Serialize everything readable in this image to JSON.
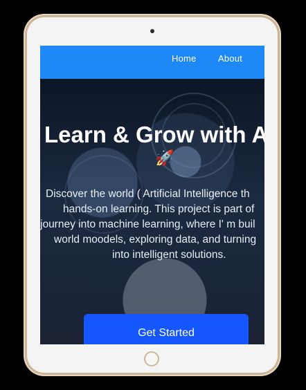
{
  "navbar": {
    "links": [
      {
        "label": "Home"
      },
      {
        "label": "About"
      }
    ]
  },
  "hero": {
    "title": "Learn & Grow with A",
    "rocket_icon": "🚀",
    "text_lines": [
      "Discover the world ( Artificial Intelligence th",
      "hands-on learning. This project is part of",
      "journey into machine learning, where I' m buil",
      "world moodels, exploring data, and turning",
      "into intelligent solutions."
    ],
    "cta_label": "Get Started"
  },
  "colors": {
    "navbar": "#1e88f7",
    "cta": "#1556ff",
    "hero_bg": "#0e1728"
  }
}
